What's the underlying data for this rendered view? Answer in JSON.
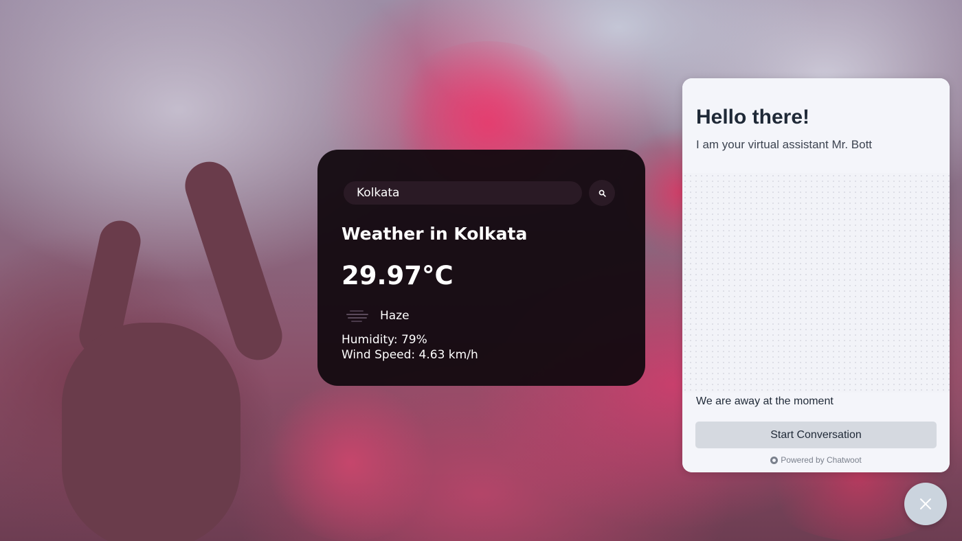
{
  "search": {
    "value": "Kolkata",
    "icon": "search-icon"
  },
  "weather": {
    "title": "Weather in Kolkata",
    "temperature": "29.97°C",
    "condition": "Haze",
    "condition_icon": "haze-icon",
    "humidity": "Humidity: 79%",
    "wind": "Wind Speed: 4.63 km/h"
  },
  "chat": {
    "greeting": "Hello there!",
    "intro": "I am your virtual assistant Mr. Bott",
    "away": "We are away at the moment",
    "start_button": "Start Conversation",
    "powered_by": "Powered by Chatwoot"
  },
  "launcher": {
    "icon": "close-icon"
  },
  "colors": {
    "card_bg": "#130a10",
    "chat_bg": "#f4f5fa",
    "button_bg": "#d5d9e0",
    "launcher_bg": "#cbd4de"
  }
}
